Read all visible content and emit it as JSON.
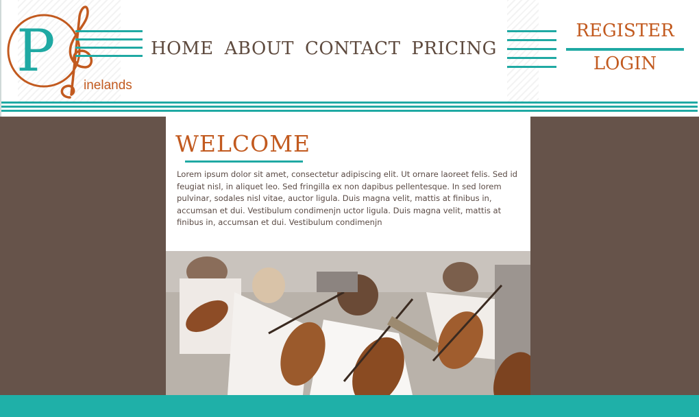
{
  "brand": {
    "logo_text": "inelands",
    "colors": {
      "teal": "#1fa9a3",
      "orange": "#c25a1f",
      "brown": "#66534a"
    }
  },
  "nav": {
    "items": [
      {
        "label": "HOME"
      },
      {
        "label": "ABOUT"
      },
      {
        "label": "CONTACT"
      },
      {
        "label": "PRICING"
      }
    ]
  },
  "auth": {
    "register": "REGISTER",
    "login": "LOGIN"
  },
  "main": {
    "heading": "WELCOME",
    "body": "Lorem ipsum dolor sit amet, consectetur adipiscing elit. Ut ornare laoreet felis. Sed id feugiat nisl, in aliquet leo. Sed fringilla ex non dapibus pellentesque. In sed lorem pulvinar, sodales nisl vitae, auctor ligula. Duis magna velit, mattis at finibus in, accumsan et dui. Vestibulum condimenjn uctor ligula. Duis magna velit, mattis at finibus in, accumsan et dui. Vestibulum condimenjn",
    "photo": "orchestra-photo"
  }
}
